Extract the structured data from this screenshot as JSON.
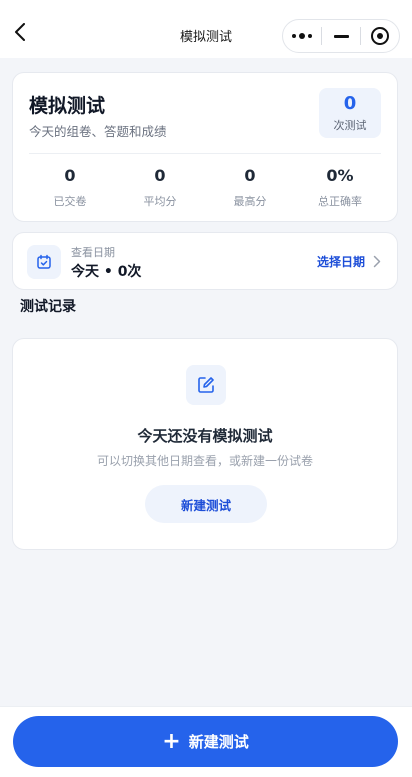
{
  "navbar": {
    "title": "模拟测试",
    "back_icon": "chevron-left-icon",
    "capsule_icons": [
      "more-icon",
      "minimize-icon",
      "target-icon"
    ]
  },
  "summary": {
    "title": "模拟测试",
    "subtitle": "今天的组卷、答题和成绩",
    "count": {
      "value": "0",
      "label": "次测试"
    },
    "stats": [
      {
        "value": "0",
        "label": "已交卷"
      },
      {
        "value": "0",
        "label": "平均分"
      },
      {
        "value": "0",
        "label": "最高分"
      },
      {
        "value": "0%",
        "label": "总正确率"
      }
    ]
  },
  "date_picker": {
    "icon": "calendar-check-icon",
    "label": "查看日期",
    "value": "今天 • 0次",
    "action_label": "选择日期",
    "action_icon": "chevron-right-icon"
  },
  "records": {
    "section_title": "测试记录",
    "empty": {
      "icon": "edit-icon",
      "title": "今天还没有模拟测试",
      "subtitle": "可以切换其他日期查看，或新建一份试卷",
      "button_label": "新建测试"
    }
  },
  "bottom_bar": {
    "primary_icon": "plus-icon",
    "primary_label": "新建测试"
  },
  "colors": {
    "accent": "#2563eb",
    "accent_soft": "#eef3fc",
    "background": "#f3f5f9"
  }
}
